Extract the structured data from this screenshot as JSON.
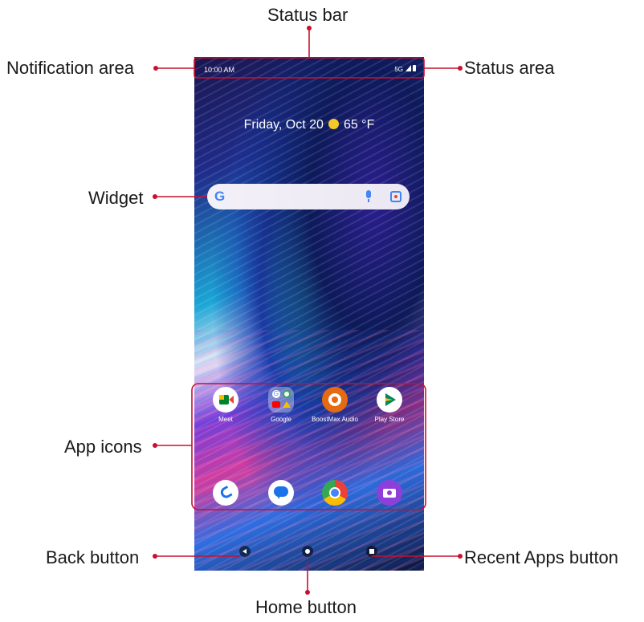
{
  "labels": {
    "status_bar": "Status bar",
    "notification_area": "Notification area",
    "status_area": "Status area",
    "widget": "Widget",
    "app_icons": "App icons",
    "back_button": "Back button",
    "recent_apps_button": "Recent Apps button",
    "home_button": "Home button"
  },
  "phone": {
    "time": "10:00 AM",
    "network": "5G",
    "date": "Friday, Oct 20",
    "temperature": "65 °F",
    "google_letter": "G",
    "apps_row1": [
      {
        "label": "Meet",
        "icon": "meet-icon"
      },
      {
        "label": "Google",
        "icon": "google-folder-icon"
      },
      {
        "label": "BoostMax Audio",
        "icon": "boostmax-icon"
      },
      {
        "label": "Play Store",
        "icon": "play-store-icon"
      }
    ],
    "apps_row2": [
      {
        "icon": "phone-icon"
      },
      {
        "icon": "messages-icon"
      },
      {
        "icon": "chrome-icon"
      },
      {
        "icon": "camera-icon"
      }
    ]
  },
  "colors": {
    "callout_red": "#c8102e"
  }
}
